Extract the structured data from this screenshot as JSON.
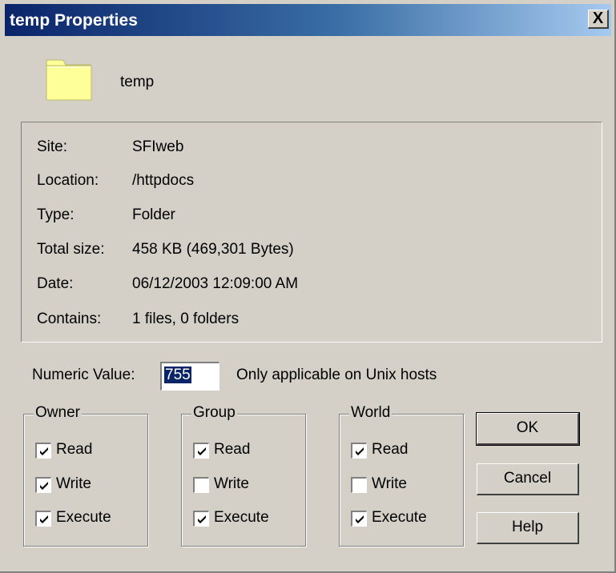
{
  "window": {
    "title": "temp Properties",
    "close_label": "X"
  },
  "folder": {
    "name": "temp",
    "icon": "folder-icon",
    "icon_color": "#ffff99"
  },
  "info": [
    {
      "label": "Site:",
      "value": "SFIweb"
    },
    {
      "label": "Location:",
      "value": "/httpdocs"
    },
    {
      "label": "Type:",
      "value": "Folder"
    },
    {
      "label": "Total size:",
      "value": "458 KB (469,301 Bytes)"
    },
    {
      "label": "Date:",
      "value": "06/12/2003 12:09:00 AM"
    },
    {
      "label": "Contains:",
      "value": "1 files, 0 folders"
    }
  ],
  "numeric": {
    "label": "Numeric Value:",
    "value": "755",
    "note": "Only applicable on Unix hosts"
  },
  "groups": [
    {
      "title": "Owner",
      "items": [
        {
          "label": "Read",
          "checked": true
        },
        {
          "label": "Write",
          "checked": true
        },
        {
          "label": "Execute",
          "checked": true
        }
      ]
    },
    {
      "title": "Group",
      "items": [
        {
          "label": "Read",
          "checked": true
        },
        {
          "label": "Write",
          "checked": false
        },
        {
          "label": "Execute",
          "checked": true
        }
      ]
    },
    {
      "title": "World",
      "items": [
        {
          "label": "Read",
          "checked": true
        },
        {
          "label": "Write",
          "checked": false
        },
        {
          "label": "Execute",
          "checked": true
        }
      ]
    }
  ],
  "buttons": {
    "ok": "OK",
    "cancel": "Cancel",
    "help": "Help"
  },
  "colors": {
    "face": "#d4d0c8",
    "title_start": "#0a246a",
    "title_end": "#a6caf0",
    "selection": "#0a246a"
  }
}
